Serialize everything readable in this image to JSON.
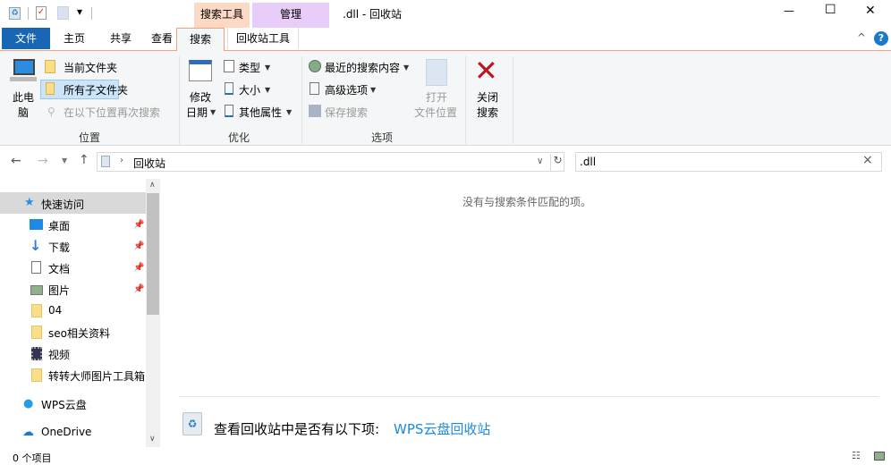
{
  "window": {
    "title": ".dll - 回收站",
    "minimize": "—",
    "maximize": "☐",
    "close": "✕"
  },
  "qat": {
    "dropdown": "▾"
  },
  "context_tabs": {
    "search_tools": "搜索工具",
    "manage": "管理"
  },
  "tabs": [
    {
      "label": "文件"
    },
    {
      "label": "主页"
    },
    {
      "label": "共享"
    },
    {
      "label": "查看"
    },
    {
      "label": "搜索"
    },
    {
      "label": "回收站工具"
    }
  ],
  "ribbon_help": {
    "collapse": "^",
    "help": "?"
  },
  "ribbon": {
    "location": {
      "group": "位置",
      "this_pc": [
        "此电",
        "脑"
      ],
      "current_folder": "当前文件夹",
      "all_subfolders": "所有子文件夹",
      "search_again": "在以下位置再次搜索"
    },
    "refine": {
      "group": "优化",
      "date_modified": [
        "修改",
        "日期"
      ],
      "kind": "类型",
      "size": "大小",
      "other_properties": "其他属性"
    },
    "options": {
      "group": "选项",
      "recent_searches": "最近的搜索内容",
      "advanced_options": "高级选项",
      "save_search": "保存搜索",
      "open_file_location": [
        "打开",
        "文件位置"
      ]
    },
    "close_search": [
      "关闭",
      "搜索"
    ]
  },
  "address": {
    "path": "回收站",
    "search_value": ".dll",
    "clear": "×",
    "refresh": "↻"
  },
  "nav": {
    "quick_access": "快速访问",
    "items": [
      {
        "label": "桌面",
        "pinned": true
      },
      {
        "label": "下载",
        "pinned": true
      },
      {
        "label": "文档",
        "pinned": true
      },
      {
        "label": "图片",
        "pinned": true
      },
      {
        "label": "04"
      },
      {
        "label": "seo相关资料"
      },
      {
        "label": "视频"
      },
      {
        "label": "转转大师图片工具箱"
      }
    ],
    "wps": "WPS云盘",
    "onedrive": "OneDrive"
  },
  "content": {
    "empty_message": "没有与搜索条件匹配的项。",
    "wps_prompt": "查看回收站中是否有以下项:",
    "wps_link": "WPS云盘回收站"
  },
  "status": {
    "count": "0 个项目"
  },
  "colors": {
    "accent": "#1979ca",
    "file_tab": "#1966b4",
    "search_tools": "#fcd9c4",
    "manage": "#e8cdf9",
    "link": "#1a8ae0"
  }
}
